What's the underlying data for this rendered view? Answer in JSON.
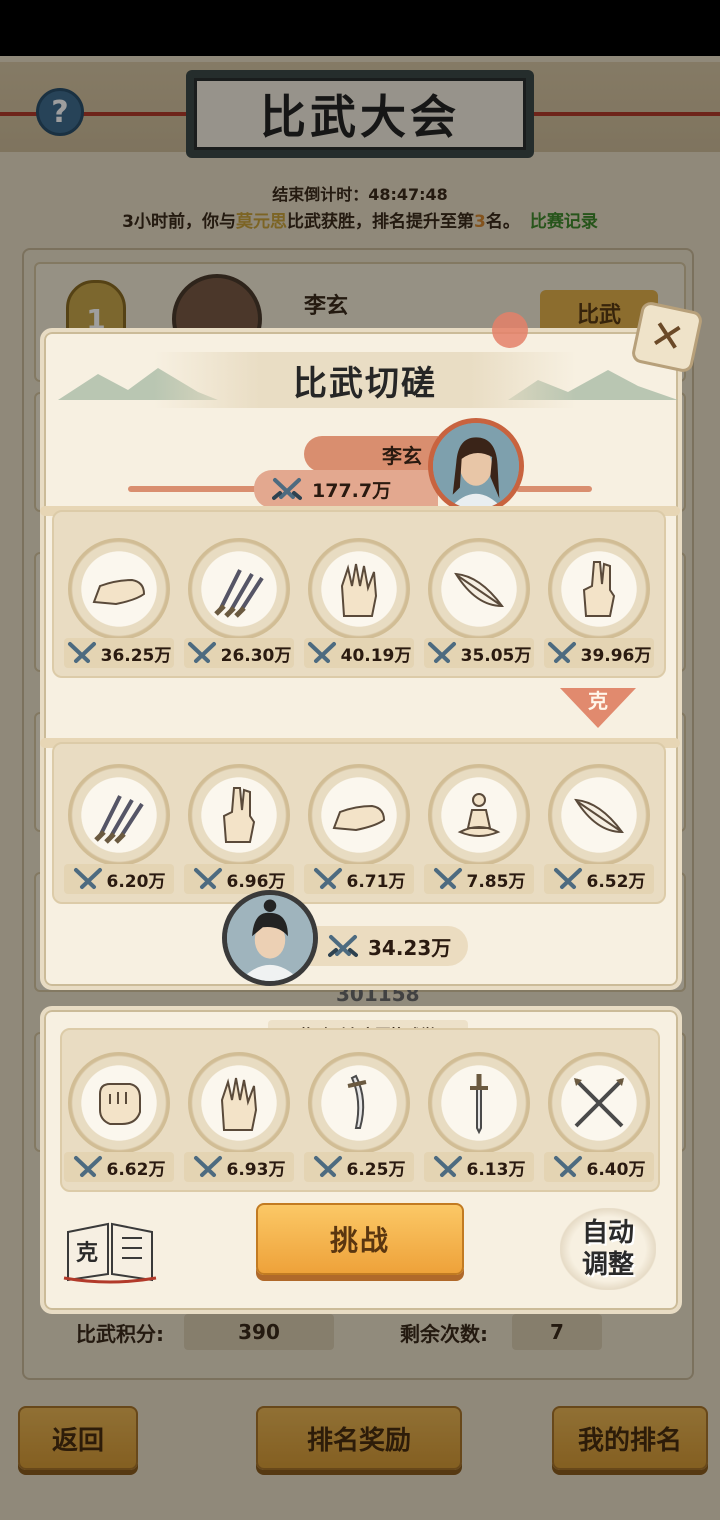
{
  "header": {
    "title": "比武大会",
    "help_icon": "?",
    "countdown_label": "结束倒计时：",
    "countdown_value": "48:47:48",
    "news_prefix": "3小时前，你与",
    "news_opponent": "莫元思",
    "news_middle": "比武获胜，排名提升至第",
    "news_rank": "3",
    "news_suffix": "名。",
    "record_link": "比赛记录"
  },
  "background_list": {
    "first_row": {
      "rank": "1",
      "name": "李玄",
      "button": "比武"
    },
    "partial_score": "301158"
  },
  "stats": {
    "score_label": "比武积分:",
    "score_value": "390",
    "remaining_label": "剩余次数:",
    "remaining_value": "7"
  },
  "bottom_buttons": {
    "back": "返回",
    "rewards": "排名奖励",
    "my_rank": "我的排名"
  },
  "dialog": {
    "title": "比武切磋",
    "opponent": {
      "name": "李玄",
      "power": "177.7万",
      "skills": [
        {
          "icon": "boot-icon",
          "value": "36.25万"
        },
        {
          "icon": "daggers-icon",
          "value": "26.30万"
        },
        {
          "icon": "palm-icon",
          "value": "40.19万"
        },
        {
          "icon": "feather-icon",
          "value": "35.05万"
        },
        {
          "icon": "finger-icon",
          "value": "39.96万"
        }
      ]
    },
    "counter_label": "克",
    "player": {
      "power": "34.23万",
      "skills": [
        {
          "icon": "daggers-icon",
          "value": "6.20万"
        },
        {
          "icon": "finger-icon",
          "value": "6.96万"
        },
        {
          "icon": "boot-icon",
          "value": "6.71万"
        },
        {
          "icon": "meditation-icon",
          "value": "7.85万"
        },
        {
          "icon": "feather-icon",
          "value": "6.52万"
        }
      ]
    }
  },
  "bench": {
    "hint": "拖动到上方更换武学",
    "skills": [
      {
        "icon": "fist-icon",
        "value": "6.62万"
      },
      {
        "icon": "palm-icon",
        "value": "6.93万"
      },
      {
        "icon": "saber-icon",
        "value": "6.25万"
      },
      {
        "icon": "sword-icon",
        "value": "6.13万"
      },
      {
        "icon": "crossed-spears-icon",
        "value": "6.40万"
      }
    ],
    "challenge_label": "挑战",
    "book_label": "克",
    "auto_adjust_line1": "自动",
    "auto_adjust_line2": "调整"
  },
  "colors": {
    "accent_orange": "#eea23a",
    "ribbon_red": "#d98e6f",
    "panel_bg": "#f7f0e1"
  }
}
